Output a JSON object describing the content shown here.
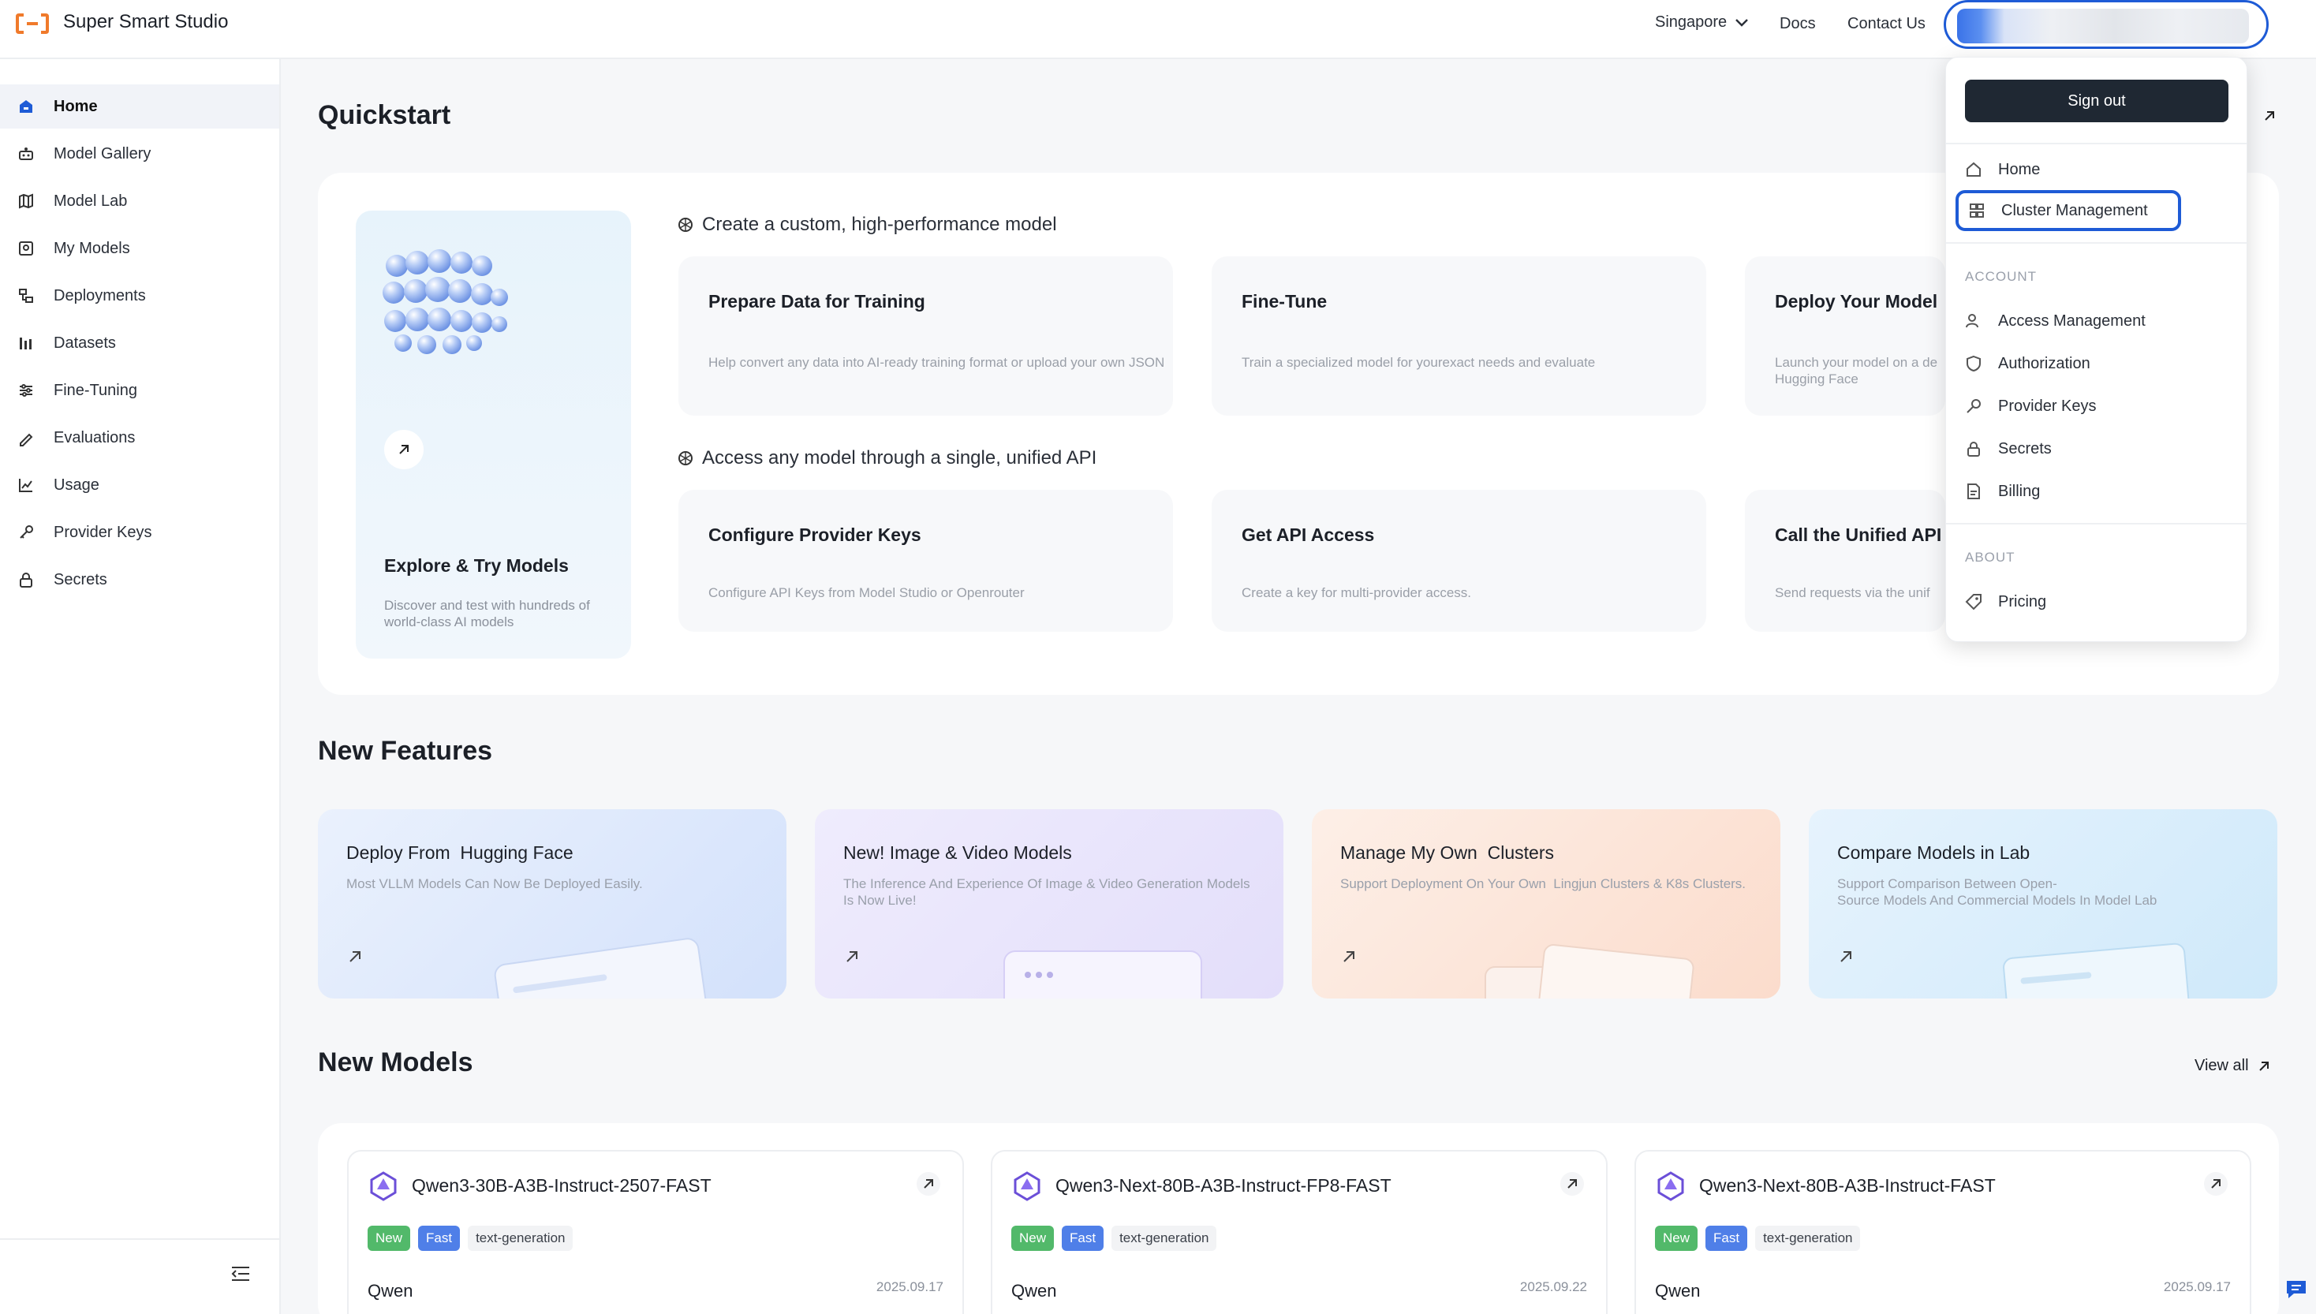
{
  "app": {
    "title": "Super Smart Studio"
  },
  "topnav": {
    "region": "Singapore",
    "docs": "Docs",
    "contact": "Contact Us"
  },
  "sidebar": {
    "items": [
      {
        "label": "Home",
        "icon": "home-icon"
      },
      {
        "label": "Model Gallery",
        "icon": "model-gallery-icon"
      },
      {
        "label": "Model Lab",
        "icon": "model-lab-icon"
      },
      {
        "label": "My Models",
        "icon": "my-models-icon"
      },
      {
        "label": "Deployments",
        "icon": "deployments-icon"
      },
      {
        "label": "Datasets",
        "icon": "datasets-icon"
      },
      {
        "label": "Fine-Tuning",
        "icon": "fine-tuning-icon"
      },
      {
        "label": "Evaluations",
        "icon": "evaluations-icon"
      },
      {
        "label": "Usage",
        "icon": "usage-icon"
      },
      {
        "label": "Provider Keys",
        "icon": "provider-keys-icon"
      },
      {
        "label": "Secrets",
        "icon": "lock-icon"
      }
    ]
  },
  "quickstart": {
    "title": "Quickstart",
    "explore": {
      "title": "Explore & Try Models",
      "desc": "Discover and test with hundreds of world-class AI models"
    },
    "group1": "Create a custom, high-performance model",
    "group2": "Access any model through a single, unified API",
    "cards_row1": [
      {
        "title": "Prepare Data for Training",
        "desc": "Help convert any data into AI-ready training format or upload your own JSON"
      },
      {
        "title": "Fine-Tune",
        "desc": "Train a specialized model for yourexact needs and evaluate"
      },
      {
        "title": "Deploy Your Model",
        "desc": "Launch your model on a de Hugging Face"
      }
    ],
    "cards_row2": [
      {
        "title": "Configure Provider Keys",
        "desc": "Configure API Keys from Model Studio or Openrouter"
      },
      {
        "title": "Get API Access",
        "desc": "Create a key for multi-provider access."
      },
      {
        "title": "Call the Unified API",
        "desc": "Send requests via the unif"
      }
    ]
  },
  "features": {
    "title": "New Features",
    "cards": [
      {
        "title": "Deploy From  Hugging Face",
        "desc": "Most VLLM Models Can Now Be Deployed Easily.",
        "bg": "#dde8fb"
      },
      {
        "title": "New! Image & Video Models",
        "desc": "The Inference And Experience Of Image & Video Generation Models Is Now Live!",
        "bg": "#e9e5fb"
      },
      {
        "title": "Manage My Own  Clusters",
        "desc": "Support Deployment On Your Own  Lingjun Clusters & K8s Clusters.",
        "bg": "#fde9df"
      },
      {
        "title": "Compare Models in Lab",
        "desc": "Support Comparison Between Open-\nSource Models And Commercial Models In Model Lab",
        "bg": "#dff0fb"
      }
    ]
  },
  "models": {
    "title": "New Models",
    "view_all": "View all",
    "cards": [
      {
        "name": "Qwen3-30B-A3B-Instruct-2507-FAST",
        "tags": [
          "New",
          "Fast",
          "text-generation"
        ],
        "provider": "Qwen",
        "date": "2025.09.17"
      },
      {
        "name": "Qwen3-Next-80B-A3B-Instruct-FP8-FAST",
        "tags": [
          "New",
          "Fast",
          "text-generation"
        ],
        "provider": "Qwen",
        "date": "2025.09.22"
      },
      {
        "name": "Qwen3-Next-80B-A3B-Instruct-FAST",
        "tags": [
          "New",
          "Fast",
          "text-generation"
        ],
        "provider": "Qwen",
        "date": "2025.09.17"
      }
    ]
  },
  "dropdown": {
    "signout": "Sign out",
    "home": "Home",
    "cluster": "Cluster Management",
    "account_heading": "ACCOUNT",
    "account_items": [
      "Access Management",
      "Authorization",
      "Provider Keys",
      "Secrets",
      "Billing"
    ],
    "about_heading": "ABOUT",
    "pricing": "Pricing"
  },
  "colors": {
    "accent": "#1e5bd6",
    "brand_orange": "#f07a2b",
    "tag_new": "#52b96a",
    "tag_fast": "#4f7fe8"
  }
}
